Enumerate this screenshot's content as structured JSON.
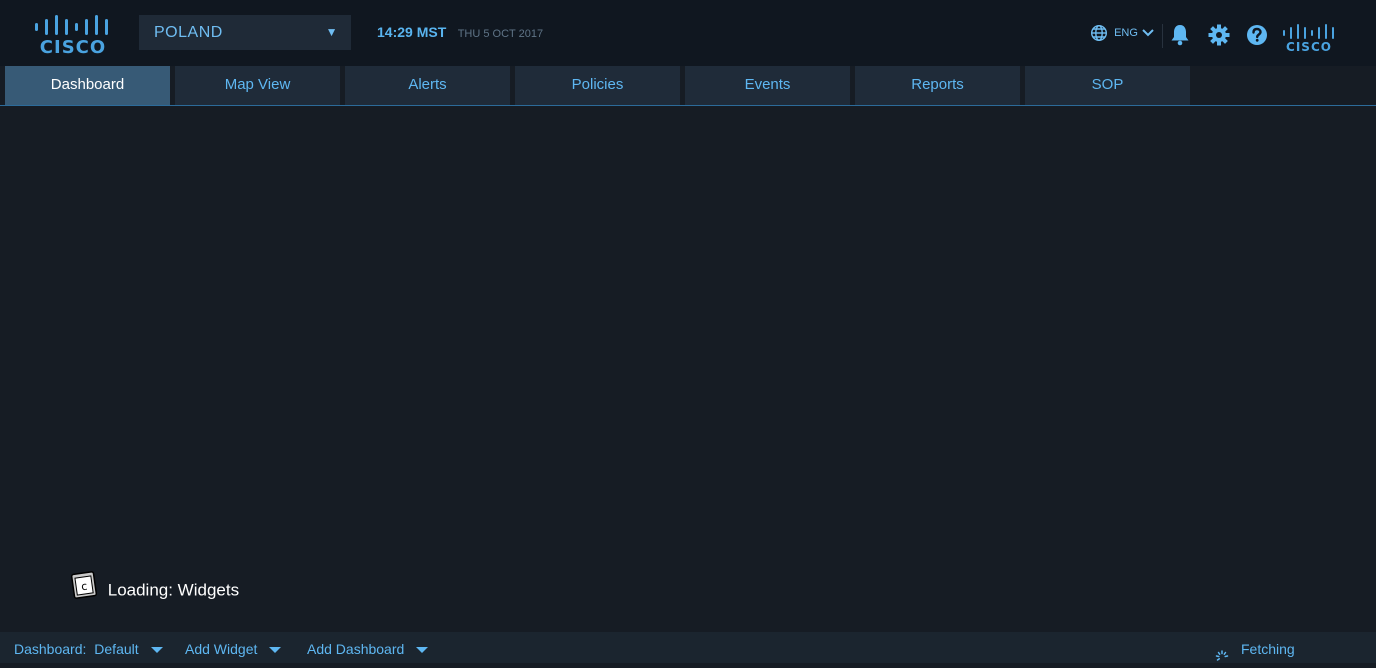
{
  "header": {
    "logo_text": "CISCO",
    "region": "POLAND",
    "time": "14:29 MST",
    "date": "THU 5 OCT 2017",
    "language": "ENG"
  },
  "icons": {
    "logo": "cisco-logo-icon",
    "region_caret": "caret-down-icon",
    "globe": "globe-icon",
    "language_chevron": "chevron-down-icon",
    "notifications": "bell-icon",
    "settings": "gear-icon",
    "help": "question-icon",
    "loading": "widget-loading-icon",
    "fetching": "spinner-icon"
  },
  "tabs": [
    {
      "label": "Dashboard",
      "active": true
    },
    {
      "label": "Map View",
      "active": false
    },
    {
      "label": "Alerts",
      "active": false
    },
    {
      "label": "Policies",
      "active": false
    },
    {
      "label": "Events",
      "active": false
    },
    {
      "label": "Reports",
      "active": false
    },
    {
      "label": "SOP",
      "active": false
    }
  ],
  "main": {
    "loading_text": "Loading: Widgets"
  },
  "footer": {
    "dashboard_label": "Dashboard:",
    "dashboard_value": "Default",
    "add_widget": "Add Widget",
    "add_dashboard": "Add Dashboard",
    "status": "Fetching"
  },
  "colors": {
    "background": "#161c24",
    "topbar": "#101720",
    "accent": "#5eb7f2",
    "tab": "#1f2b39",
    "tab_active": "#375a76"
  }
}
